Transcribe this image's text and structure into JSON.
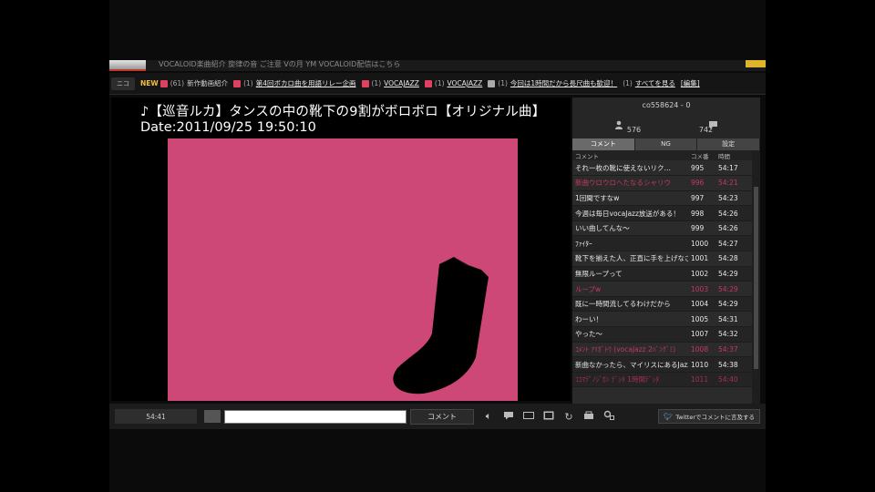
{
  "topstrip": {
    "text": "VOCALOID楽曲紹介 旋律の音 ご注意 Vの月 YM  VOCALOID配信はこちら"
  },
  "infobar": {
    "logo": "ニコ",
    "new_label": "NEW",
    "items": [
      {
        "prefix": "",
        "text": "新作動画紹介",
        "count": "(61)",
        "badge": "pink",
        "link": false,
        "is_new": true
      },
      {
        "prefix": "",
        "text": "第4回ボカロ曲を用語リレー企画",
        "count": "(1)",
        "badge": "pink",
        "link": true
      },
      {
        "prefix": "",
        "text": "VOCAJAZZ",
        "count": "(1)",
        "badge": "pink",
        "link": true
      },
      {
        "prefix": "",
        "text": "VOCAJAZZ",
        "count": "(1)",
        "badge": "pink",
        "link": true
      },
      {
        "prefix": "",
        "text": "今回は1時間だから長尺曲も歓迎！",
        "count": "(1)",
        "badge": "gray",
        "link": true
      },
      {
        "prefix": "",
        "text": "すべてを見る",
        "count": "(1)",
        "badge": "none",
        "link": true
      },
      {
        "prefix": "",
        "text": "[編集]",
        "count": "",
        "badge": "none",
        "link": true
      }
    ]
  },
  "video": {
    "title": "♪【巡音ルカ】タンスの中の靴下の9割がボロボロ【オリジナル曲】",
    "date": "Date:2011/09/25 19:50:10",
    "colors": {
      "background": "#cd4777",
      "figure": "#000000"
    }
  },
  "panel": {
    "user": "co558624 - 0",
    "viewers": "576",
    "comments": "742",
    "tabs": [
      "コメント",
      "NG",
      "設定"
    ],
    "columns": [
      "コメント",
      "コメ番",
      "時間"
    ],
    "rows": [
      {
        "comment": "それ一枚の靴に使えないリク…",
        "num": "995",
        "time": "54:17",
        "style": ""
      },
      {
        "comment": "新曲ウロウロへたなるシャリウ",
        "num": "996",
        "time": "54:21",
        "style": "hl"
      },
      {
        "comment": "1回聞ですなw",
        "num": "997",
        "time": "54:23",
        "style": ""
      },
      {
        "comment": "今週は毎日vocaJazz放送がある！",
        "num": "998",
        "time": "54:26",
        "style": "alt"
      },
      {
        "comment": "いい曲してんな～",
        "num": "999",
        "time": "54:26",
        "style": ""
      },
      {
        "comment": "ﾌｧｲﾀｰ",
        "num": "1000",
        "time": "54:27",
        "style": "alt"
      },
      {
        "comment": "靴下を揃えた人、正直に手を上げなさい",
        "num": "1001",
        "time": "54:28",
        "style": ""
      },
      {
        "comment": "無限ループって",
        "num": "1002",
        "time": "54:29",
        "style": "alt"
      },
      {
        "comment": "ループw",
        "num": "1003",
        "time": "54:29",
        "style": "hl"
      },
      {
        "comment": "既に一時間流してるわけだから",
        "num": "1004",
        "time": "54:29",
        "style": "alt"
      },
      {
        "comment": "わーい！",
        "num": "1005",
        "time": "54:31",
        "style": ""
      },
      {
        "comment": "やった～",
        "num": "1007",
        "time": "54:32",
        "style": "alt"
      },
      {
        "comment": "ｺﾒﾝﾄ ｱﾘｶﾞﾄｳ (vocaJazz 2ﾊﾞﾝｸﾞﾐ)",
        "num": "1008",
        "time": "54:37",
        "style": "hl"
      },
      {
        "comment": "新曲なかったら、マイリスにあるJazz",
        "num": "1010",
        "time": "54:38",
        "style": "alt"
      },
      {
        "comment": "ｺｺﾏﾃﾞﾉｼﾞｶﾝ ﾃﾞｼﾀ 1時間ﾃﾞｼﾀ",
        "num": "1011",
        "time": "54:40",
        "style": "hlalt"
      }
    ]
  },
  "controls": {
    "time": "54:41",
    "comment_button": "コメント",
    "twitter_button": "Twitterでコメントに言及する"
  }
}
